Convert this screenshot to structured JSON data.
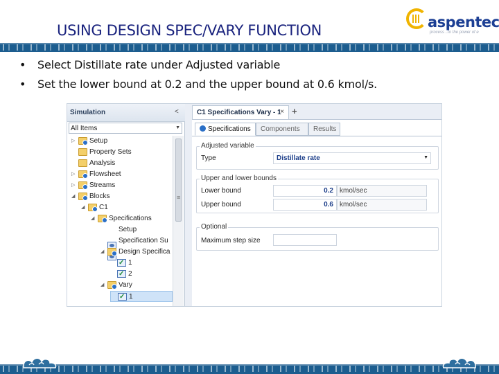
{
  "slide": {
    "title": "USING DESIGN SPEC/VARY FUNCTION",
    "logo_text": "aspentech",
    "logo_tagline": "process ..to the power of e",
    "bullet_glyph": "•",
    "bullets": [
      "Select Distillate rate under Adjusted variable",
      "Set the lower bound at 0.2 and the upper bound at 0.6 kmol/s."
    ],
    "band_color": "#1c5d8f",
    "title_color": "#1a237e"
  },
  "nav": {
    "title": "Simulation",
    "collapse_glyph": "<",
    "filter_value": "All Items",
    "tree": [
      {
        "label": "Setup",
        "icon": "folder-check-icon",
        "toggle": "▷",
        "level": 0
      },
      {
        "label": "Property Sets",
        "icon": "folder-icon",
        "toggle": "",
        "level": 0
      },
      {
        "label": "Analysis",
        "icon": "folder-icon",
        "toggle": "",
        "level": 0
      },
      {
        "label": "Flowsheet",
        "icon": "folder-check-icon",
        "toggle": "▷",
        "level": 0
      },
      {
        "label": "Streams",
        "icon": "folder-check-icon",
        "toggle": "▷",
        "level": 0
      },
      {
        "label": "Blocks",
        "icon": "folder-check-icon",
        "toggle": "◢",
        "level": 0
      },
      {
        "label": "C1",
        "icon": "folder-check-icon",
        "toggle": "◢",
        "level": 1
      },
      {
        "label": "Specifications",
        "icon": "folder-check-icon",
        "toggle": "◢",
        "level": 2
      },
      {
        "label": "Setup",
        "icon": "form-icon",
        "toggle": "",
        "level": 3
      },
      {
        "label": "Specification Su",
        "icon": "form-icon",
        "toggle": "",
        "level": 3
      },
      {
        "label": "Design Specifica",
        "icon": "folder-check-icon",
        "toggle": "◢",
        "level": 3
      },
      {
        "label": "1",
        "icon": "checked-form-icon",
        "toggle": "",
        "level": 4
      },
      {
        "label": "2",
        "icon": "checked-form-icon",
        "toggle": "",
        "level": 4
      },
      {
        "label": "Vary",
        "icon": "folder-check-icon",
        "toggle": "◢",
        "level": 3
      },
      {
        "label": "1",
        "icon": "checked-form-icon",
        "toggle": "",
        "level": 4,
        "selected": true
      }
    ]
  },
  "document": {
    "tab_label": "C1 Specifications Vary - 1",
    "tab_close": "×",
    "new_tab_glyph": "+",
    "subtabs": [
      {
        "label": "Specifications",
        "active": true
      },
      {
        "label": "Components",
        "active": false
      },
      {
        "label": "Results",
        "active": false
      }
    ],
    "adjusted_variable": {
      "group_title": "Adjusted variable",
      "type_label": "Type",
      "type_value": "Distillate rate"
    },
    "bounds": {
      "group_title": "Upper and lower bounds",
      "lower_label": "Lower bound",
      "lower_value": "0.2",
      "lower_unit": "kmol/sec",
      "upper_label": "Upper bound",
      "upper_value": "0.6",
      "upper_unit": "kmol/sec"
    },
    "optional": {
      "group_title": "Optional",
      "max_step_label": "Maximum step size",
      "max_step_value": ""
    }
  }
}
